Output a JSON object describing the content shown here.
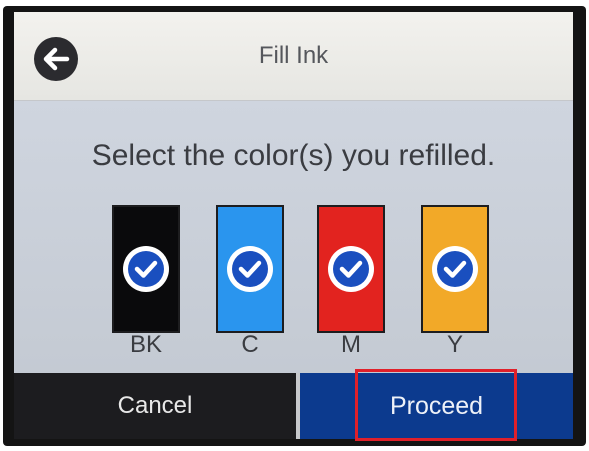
{
  "header": {
    "title": "Fill Ink",
    "back_icon": "back-arrow-icon"
  },
  "prompt": "Select the color(s) you refilled.",
  "inks": [
    {
      "label": "BK",
      "color": "#0a0a0c",
      "selected": true
    },
    {
      "label": "C",
      "color": "#2a95ee",
      "selected": true
    },
    {
      "label": "M",
      "color": "#e2231f",
      "selected": true
    },
    {
      "label": "Y",
      "color": "#f2a928",
      "selected": true
    }
  ],
  "check_color": "#1a4fbf",
  "footer": {
    "cancel_label": "Cancel",
    "proceed_label": "Proceed"
  },
  "highlight_color": "#e0202a"
}
